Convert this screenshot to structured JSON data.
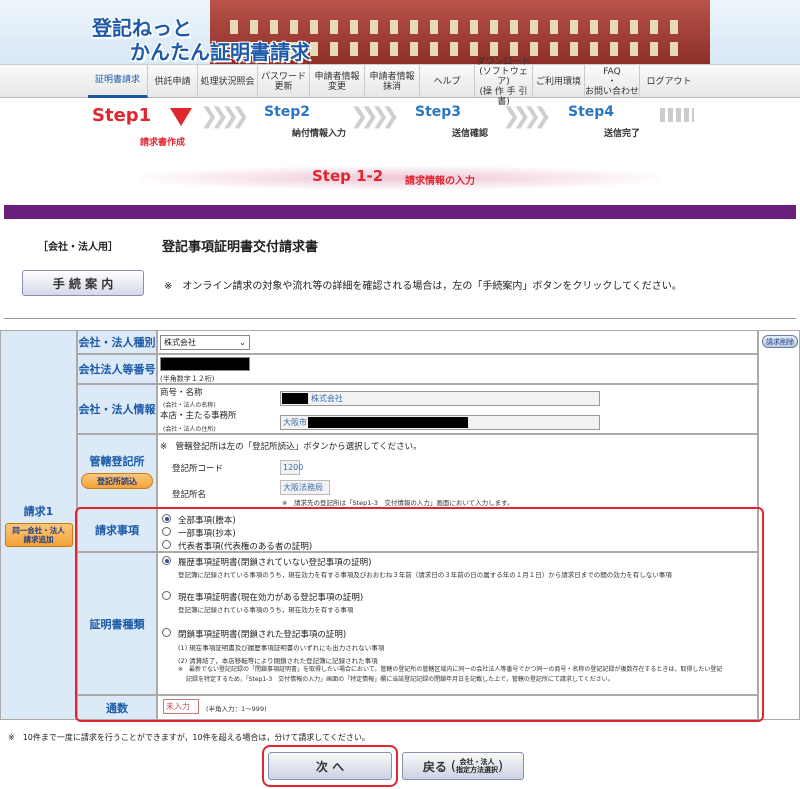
{
  "header": {
    "logo_line1": "登記ねっと",
    "logo_line2": "かんたん証明書請求"
  },
  "nav": [
    {
      "label": "証明書請求",
      "active": true
    },
    {
      "label": "供託申請"
    },
    {
      "label": "処理状況照会"
    },
    {
      "label": "パスワード\n更新"
    },
    {
      "label": "申請者情報\n変更"
    },
    {
      "label": "申請者情報\n抹消"
    },
    {
      "label": "ヘルプ"
    },
    {
      "label": "ダウンロード\n(ソフトウェア)\n(操 作 手 引 書)"
    },
    {
      "label": "ご利用環境"
    },
    {
      "label": "FAQ\n・\nお問い合わせ"
    },
    {
      "label": "ログアウト"
    }
  ],
  "steps": {
    "step1": "Step1",
    "step1_sub": "請求書作成",
    "step2": "Step2",
    "step2_sub": "納付情報入力",
    "step3": "Step3",
    "step3_sub": "送信確認",
    "step4": "Step4",
    "step4_sub": "送信完了"
  },
  "substep": {
    "num": "Step 1-2",
    "title": "請求情報の入力"
  },
  "page": {
    "category": "［会社・法人用］",
    "title": "登記事項証明書交付請求書",
    "guide_button": "手 続 案 内",
    "guide_note": "※　オンライン請求の対象や流れ等の詳細を確認される場合は，左の「手続案内」ボタンをクリックしてください。"
  },
  "form": {
    "request_label": "請求1",
    "add_same_button": "同一会社・法人\n請求追加",
    "delete_button": "請求削除",
    "corp_type_label": "会社・法人種別",
    "corp_type_value": "株式会社",
    "corp_number_label": "会社法人等番号",
    "corp_number_hint": "(半角数字１２桁)",
    "corp_info_label": "会社・法人情報",
    "trade_name_label": "商号・名称",
    "trade_name_sub": "(会社・法人の名称)",
    "trade_name_value": "株式会社",
    "office_label": "本店・主たる事務所",
    "office_sub": "(会社・法人の住所)",
    "office_value": "大阪市",
    "registry_label": "管轄登記所",
    "registry_read_button": "登記所読込",
    "registry_note": "※　管轄登記所は左の「登記所読込」ボタンから選択してください。",
    "registry_code_label": "登記所コード",
    "registry_code_value": "1200",
    "registry_name_label": "登記所名",
    "registry_name_value": "大阪法務局",
    "registry_name_note": "※　請求先の登記所は「Step1-3　交付情報の入力」画面において入力します。",
    "request_item_label": "請求事項",
    "request_items": [
      {
        "label": "全部事項(謄本)",
        "checked": true
      },
      {
        "label": "一部事項(抄本)",
        "checked": false
      },
      {
        "label": "代表者事項(代表権のある者の証明)",
        "checked": false
      }
    ],
    "cert_type_label": "証明書種類",
    "cert_types": [
      {
        "label": "履歴事項証明書(閉鎖されていない登記事項の証明)",
        "checked": true,
        "note": "登記簿に記録されている事項のうち，現在効力を有する事項及びおおむね３年前（請求日の３年前の日の属する年の１月１日）から請求日までの間の効力を有しない事項"
      },
      {
        "label": "現在事項証明書(現在効力がある登記事項の証明)",
        "checked": false,
        "note": "登記簿に記録されている事項のうち，現在効力を有する事項"
      },
      {
        "label": "閉鎖事項証明書(閉鎖された登記事項の証明)",
        "checked": false,
        "note": "(1) 現在事項証明書及び履歴事項証明書のいずれにも出力されない事項",
        "note2": "(2) 清算結了，本店移転等により閉鎖された登記簿に記録された事項",
        "note3": "※　最新でない登記記録の「閉鎖事項証明書」を取得したい場合において，管轄の登記所の管轄区域内に同一の会社法人等番号でかつ同一の商号・名称の登記記録が複数存在するときは，取得したい登記",
        "note4": "記録を特定するため，「Step1-3　交付情報の入力」画面の「特定情報」欄に当該登記記録の閉鎖年月日を記載した上で，管轄の登記所にて請求してください。"
      }
    ],
    "copies_label": "通数",
    "copies_placeholder": "未入力",
    "copies_hint": "(半角入力：1〜999)"
  },
  "footer": {
    "limit_note": "※　10件まで一度に請求を行うことができますが，10件を超える場合は，分けて請求してください。",
    "next_button": "次 へ",
    "back_button": "戻る",
    "back_sub": "会社・法人\n指定方法選択"
  },
  "colors": {
    "accent_blue": "#1c5aa8",
    "purple_bar": "#6b1f7c",
    "highlight_red": "#e0262f",
    "orange_button": "#f5a23a"
  }
}
